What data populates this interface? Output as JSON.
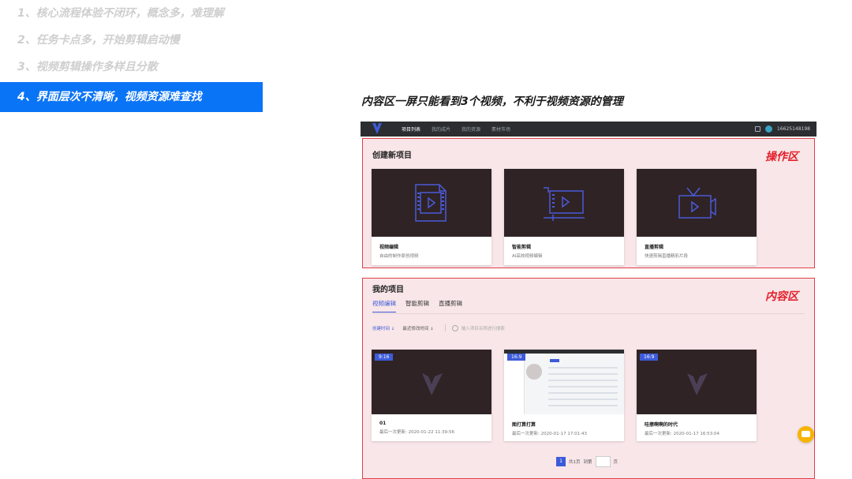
{
  "left_list": [
    "1、核心流程体验不闭环，概念多，难理解",
    "2、任务卡点多，开始剪辑启动慢",
    "3、视频剪辑操作多样且分散",
    "4、界面层次不清晰，视频资源难查找"
  ],
  "headline": "内容区一屏只能看到3个视频，不利于视频资源的管理",
  "app": {
    "nav": [
      "项目列表",
      "我的成片",
      "我的资源",
      "素材市场"
    ],
    "phone": "16625148198",
    "operation_zone": {
      "title": "创建新项目",
      "label": "操作区",
      "cards": [
        {
          "title": "视频编辑",
          "desc": "自由的制作原创视频",
          "icon": "film-icon"
        },
        {
          "title": "智能剪辑",
          "desc": "AI高效视频编辑",
          "icon": "timeline-icon"
        },
        {
          "title": "直播剪辑",
          "desc": "快速剪辑直播精彩片段",
          "icon": "tv-icon"
        }
      ]
    },
    "content_zone": {
      "title": "我的项目",
      "label": "内容区",
      "tabs": [
        "视频编辑",
        "智能剪辑",
        "直播剪辑"
      ],
      "sort_primary": "创建时间 ↓",
      "sort_secondary": "最近修改时间 ↓",
      "search_placeholder": "输入项目名称进行搜索",
      "projects": [
        {
          "ratio": "9:16",
          "name": "01",
          "updated": "最后一次更新:  2020-01-22 11:39:56"
        },
        {
          "ratio": "16:9",
          "name": "图打算打算",
          "updated": "最后一次更新:  2020-01-17 17:01:43"
        },
        {
          "ratio": "16:9",
          "name": "哇擦啊啊的时代",
          "updated": "最后一次更新:  2020-01-17 16:53:04"
        }
      ],
      "pager": {
        "page": "1",
        "total": "共1页",
        "goto": "到第",
        "unit": "页"
      }
    }
  },
  "colors": {
    "accent": "#0a74f7",
    "brand": "#3d5bd9",
    "zone_border": "#e0404a",
    "zone_fill": "#f9e6e8",
    "zone_label": "#e3202b"
  }
}
